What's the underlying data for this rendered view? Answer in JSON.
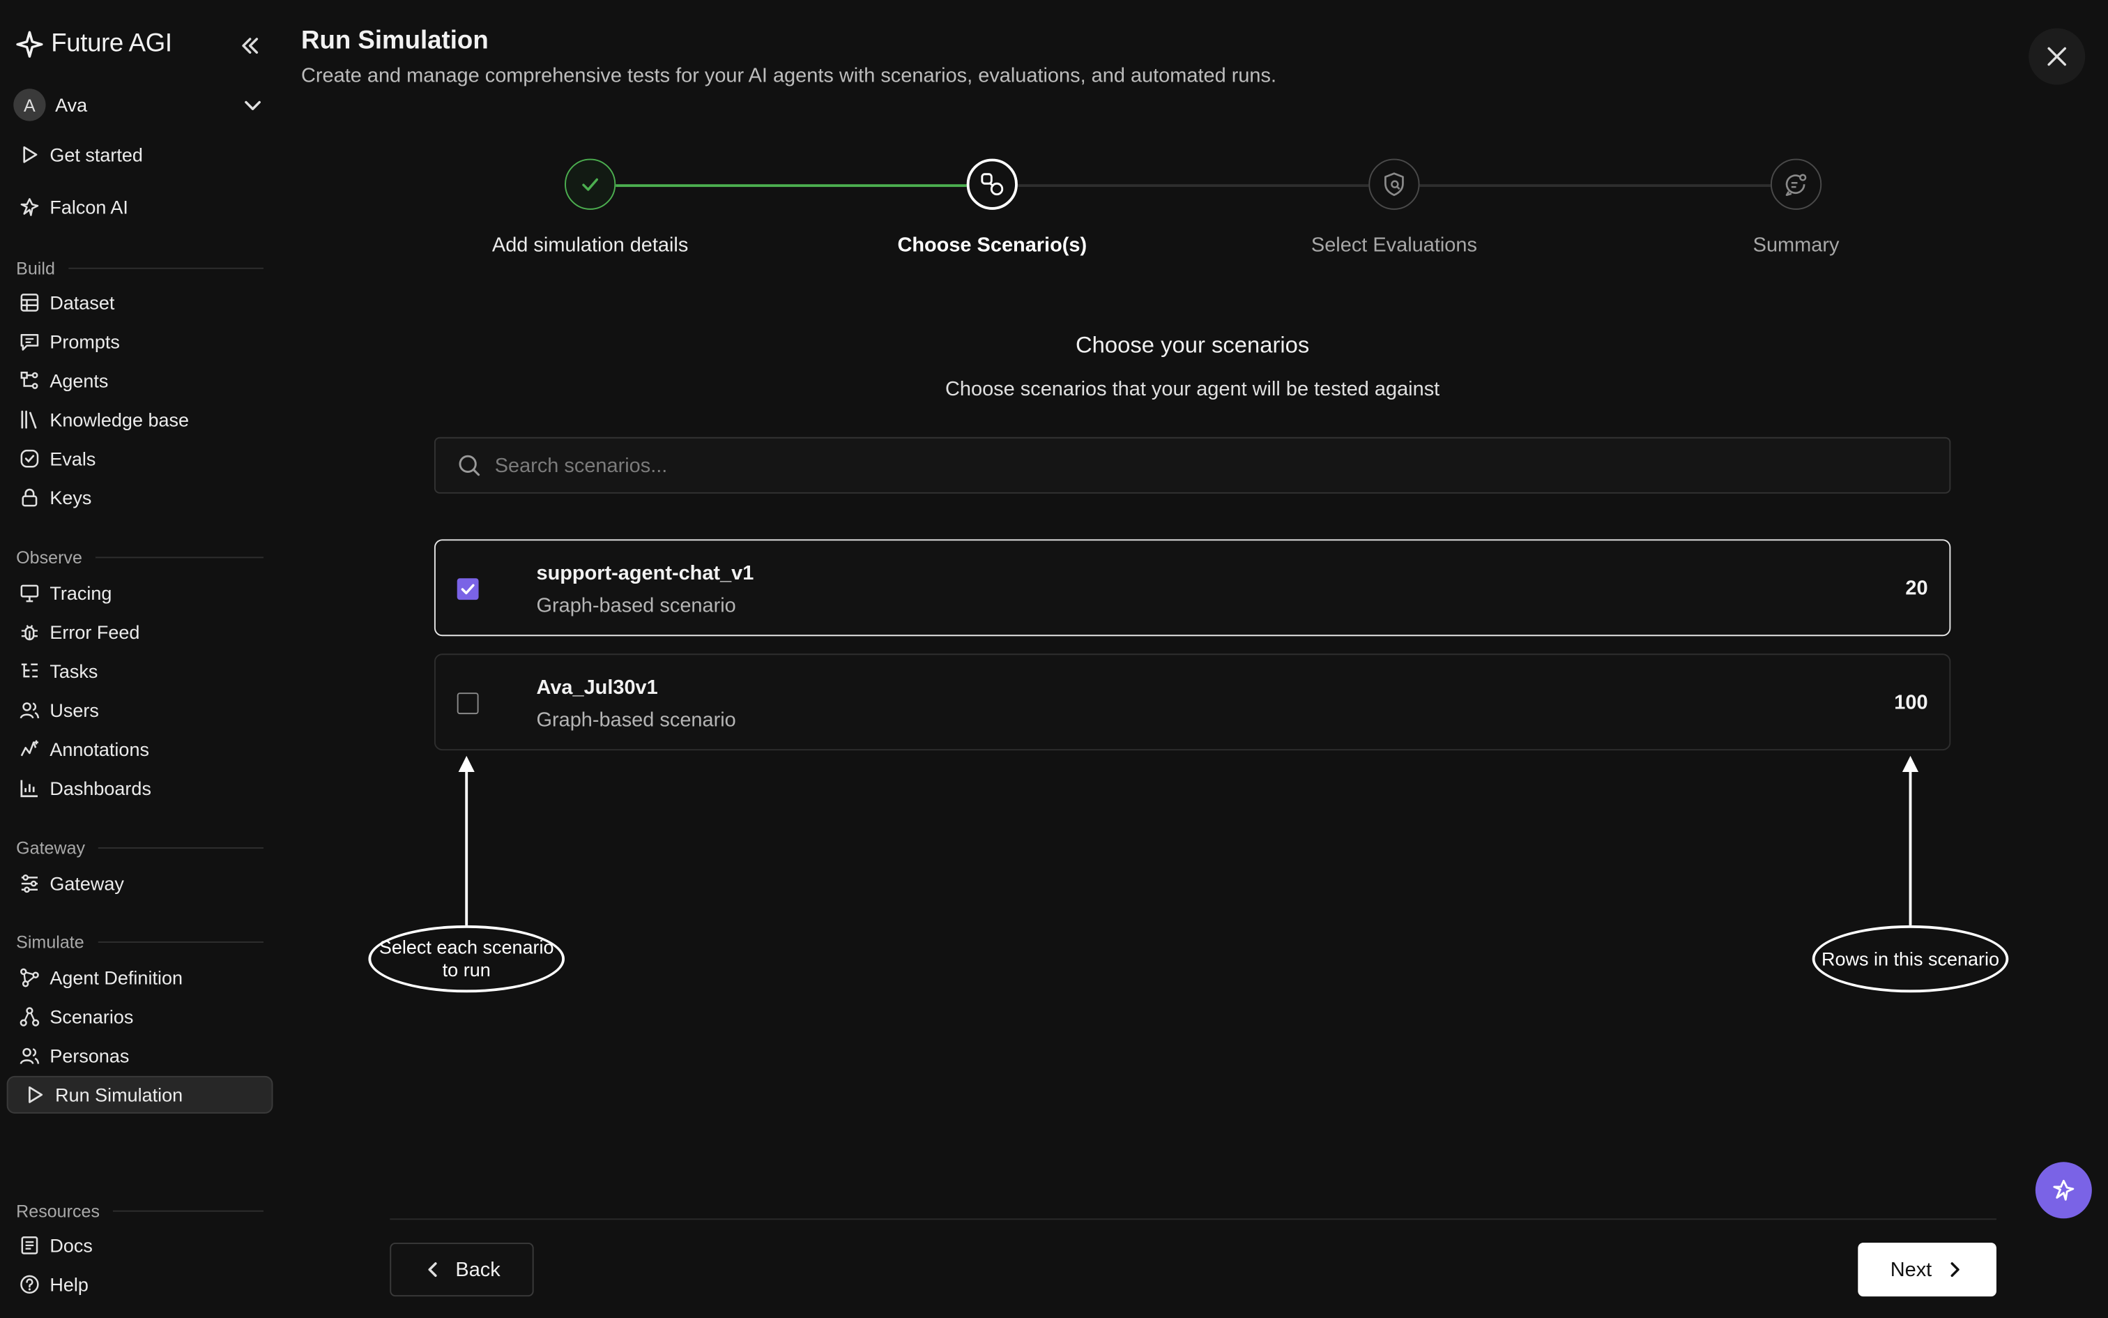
{
  "brand": {
    "name": "Future AGI"
  },
  "workspace": {
    "initial": "A",
    "name": "Ava"
  },
  "sidebar": {
    "top_items": [
      {
        "label": "Get started",
        "icon": "play-icon"
      },
      {
        "label": "Falcon AI",
        "icon": "falcon-icon"
      }
    ],
    "sections": {
      "build": "Build",
      "observe": "Observe",
      "gateway": "Gateway",
      "simulate": "Simulate",
      "resources": "Resources"
    },
    "build_items": [
      "Dataset",
      "Prompts",
      "Agents",
      "Knowledge base",
      "Evals",
      "Keys"
    ],
    "observe_items": [
      "Tracing",
      "Error Feed",
      "Tasks",
      "Users",
      "Annotations",
      "Dashboards"
    ],
    "gateway_items": [
      "Gateway"
    ],
    "simulate_items": [
      "Agent Definition",
      "Scenarios",
      "Personas",
      "Run Simulation"
    ],
    "resources_items": [
      "Docs",
      "Help"
    ]
  },
  "page": {
    "title": "Run Simulation",
    "subtitle": "Create and manage comprehensive tests for your AI agents with scenarios, evaluations, and automated runs."
  },
  "steps": [
    {
      "label": "Add simulation details",
      "state": "done"
    },
    {
      "label": "Choose Scenario(s)",
      "state": "active"
    },
    {
      "label": "Select Evaluations",
      "state": "pending"
    },
    {
      "label": "Summary",
      "state": "pending"
    }
  ],
  "content": {
    "heading": "Choose your scenarios",
    "subheading": "Choose scenarios that your agent will be tested against",
    "search_placeholder": "Search scenarios..."
  },
  "scenarios": [
    {
      "name": "support-agent-chat_v1",
      "type": "Graph-based scenario",
      "count": "20",
      "selected": true
    },
    {
      "name": "Ava_Jul30v1",
      "type": "Graph-based scenario",
      "count": "100",
      "selected": false
    }
  ],
  "annotations": {
    "select": "Select each scenario to run",
    "rows": "Rows in this scenario"
  },
  "footer": {
    "back": "Back",
    "next": "Next"
  },
  "colors": {
    "accent": "#7a63e6",
    "success": "#4caf50",
    "background": "#111111"
  }
}
